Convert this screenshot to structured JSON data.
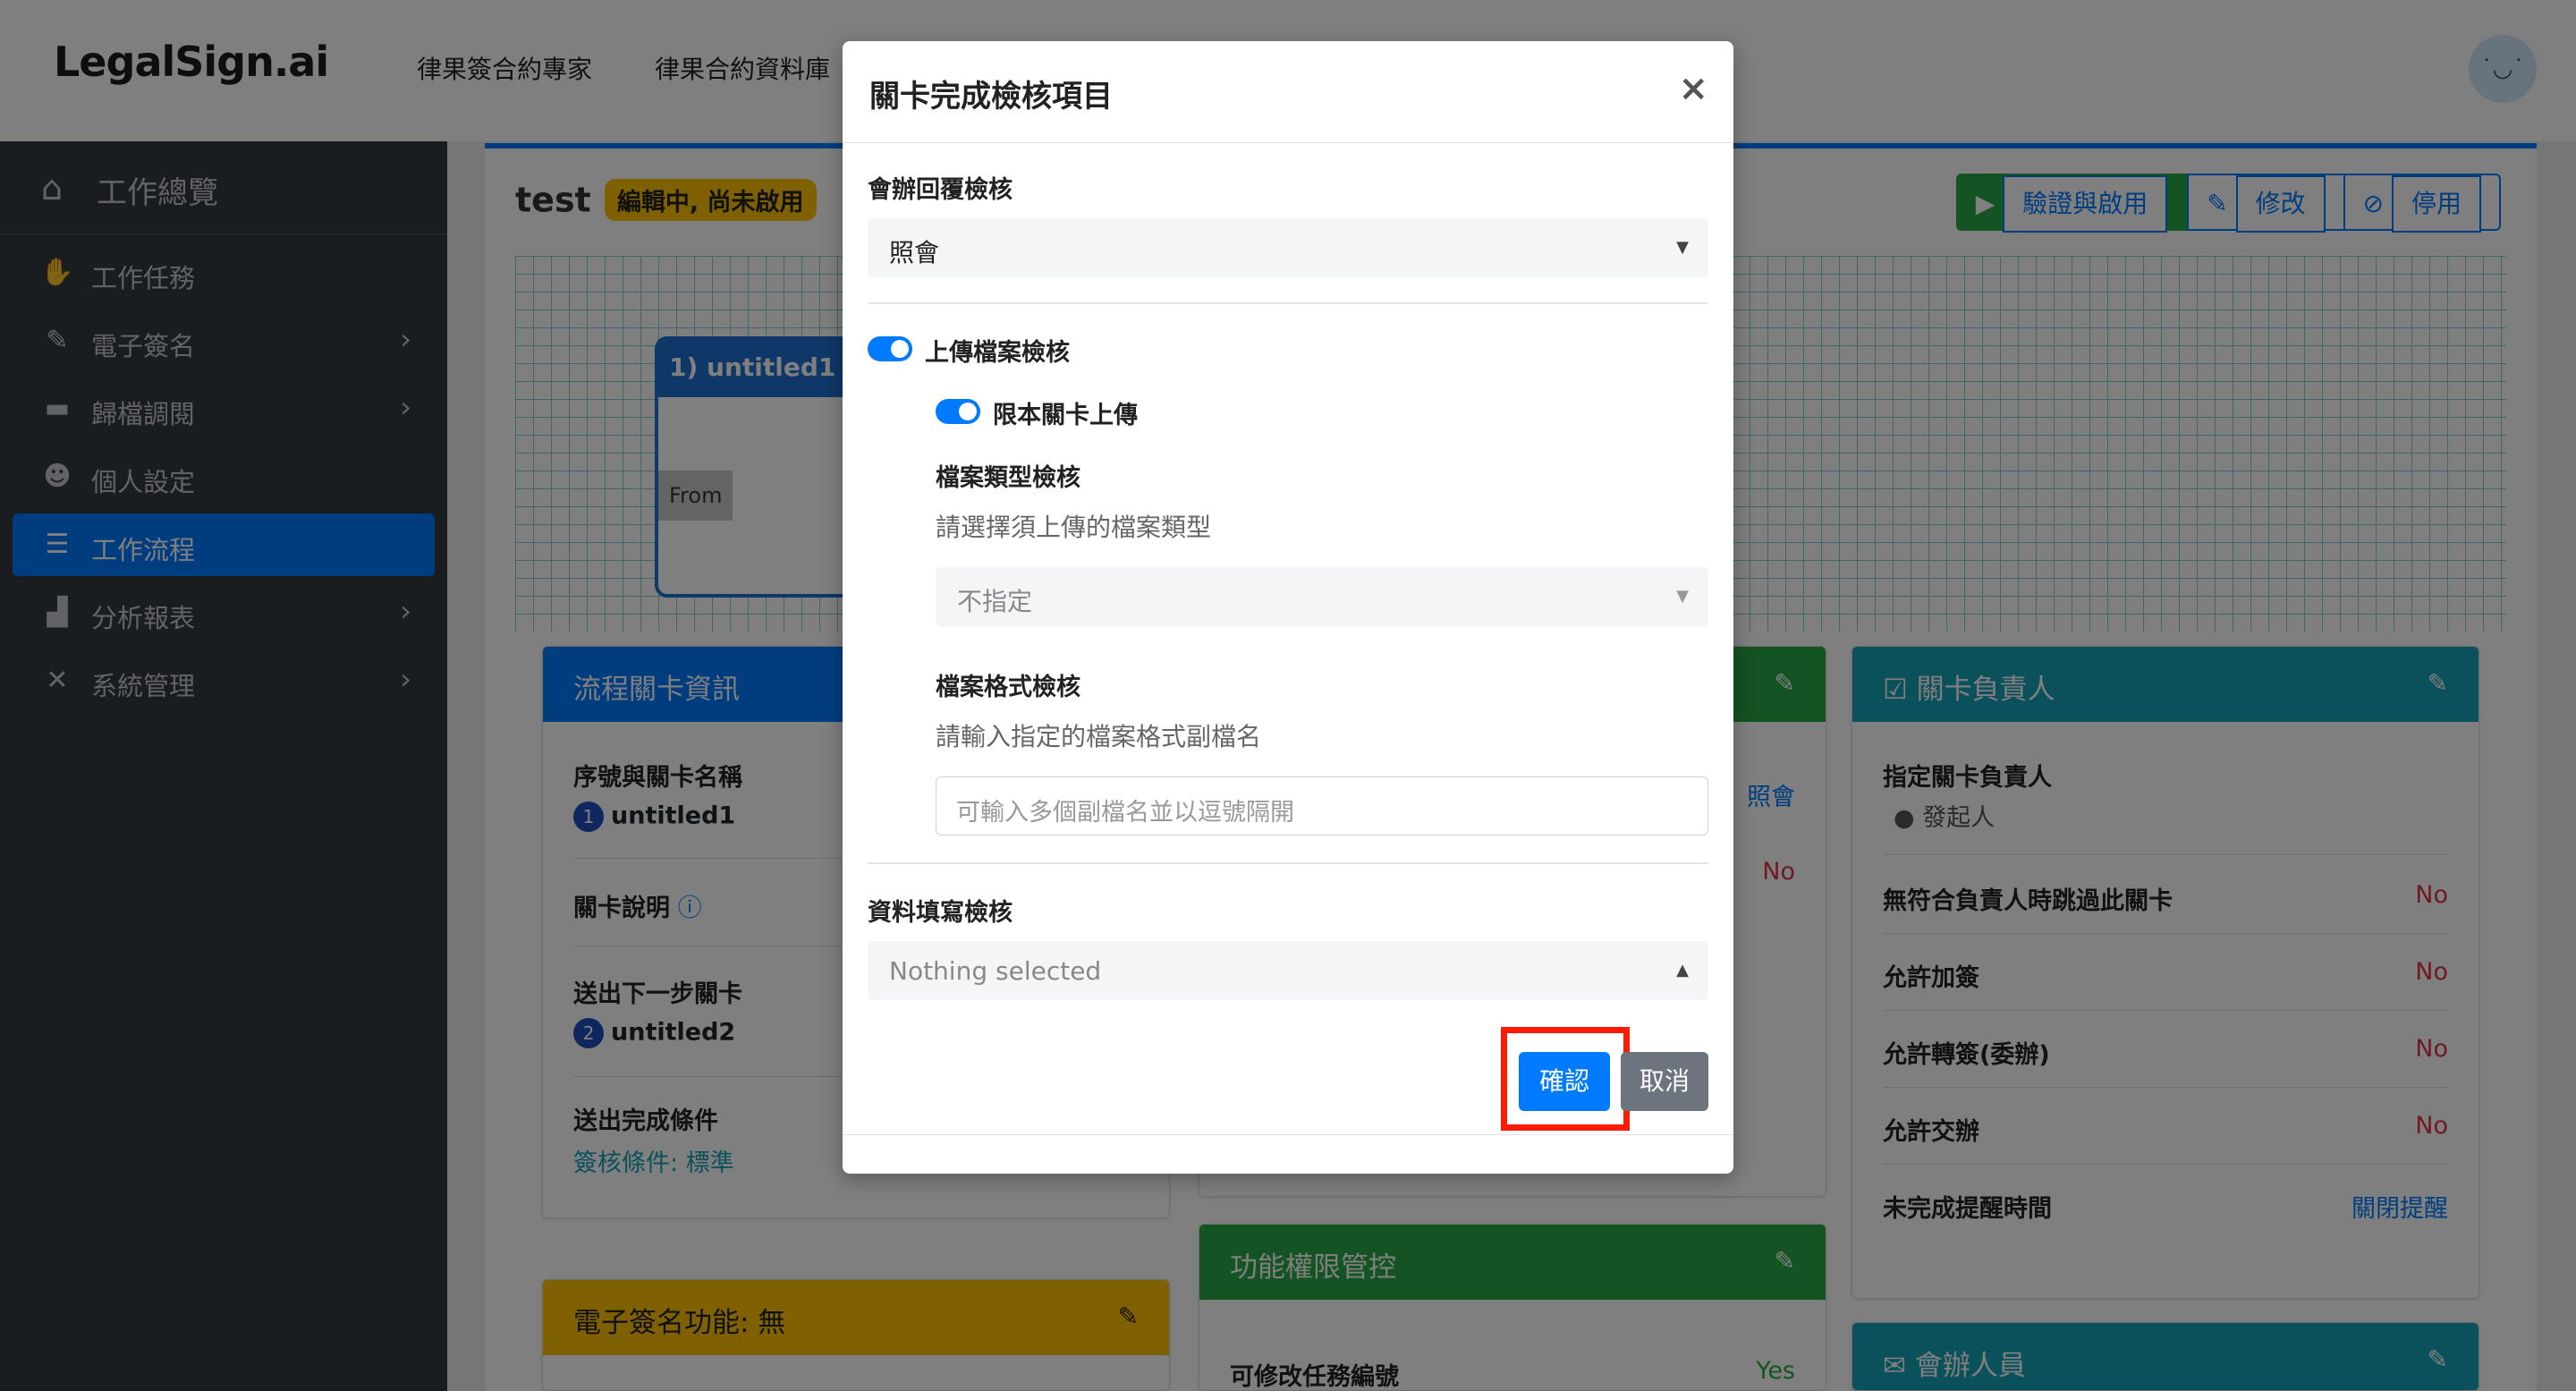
{
  "app": {
    "logo": "LegalSign.ai"
  },
  "topnav": {
    "item1": "律果簽合約專家",
    "item2": "律果合約資料庫"
  },
  "avatar": {
    "face": "˙◡˙"
  },
  "sidebar": {
    "overview": "工作總覽",
    "items": [
      {
        "label": "工作任務",
        "icon": "handshake-icon",
        "glyph": "✋",
        "chevron": false
      },
      {
        "label": "電子簽名",
        "icon": "signature-icon",
        "glyph": "✎",
        "chevron": true
      },
      {
        "label": "歸檔調閱",
        "icon": "archive-icon",
        "glyph": "▬",
        "chevron": true
      },
      {
        "label": "個人設定",
        "icon": "user-cog-icon",
        "glyph": "☻",
        "chevron": false
      },
      {
        "label": "工作流程",
        "icon": "list-icon",
        "glyph": "☰",
        "chevron": false
      },
      {
        "label": "分析報表",
        "icon": "chart-icon",
        "glyph": "▟",
        "chevron": true
      },
      {
        "label": "系統管理",
        "icon": "tools-icon",
        "glyph": "✕",
        "chevron": true
      }
    ]
  },
  "main": {
    "title": "test",
    "status_badge": "編輯中, 尚未啟用",
    "buttons": {
      "verify": "驗證與啟用",
      "edit": "修改",
      "disable": "停用"
    },
    "node": {
      "title": "1) untitled1",
      "from": "From"
    }
  },
  "panel_info": {
    "title": "流程關卡資訊",
    "seq_label": "序號與關卡名稱",
    "seq_num": "1",
    "seq_value": "untitled1",
    "desc_label": "關卡說明",
    "next_label": "送出下一步關卡",
    "next_num": "2",
    "next_value": "untitled2",
    "cond_label": "送出完成條件",
    "cond_value": "簽核條件: 標準"
  },
  "panel_mid": {
    "val1": "照會",
    "val2": "No"
  },
  "panel_owner": {
    "title": "關卡負責人",
    "assign_label": "指定關卡負責人",
    "assign_value": "發起人",
    "rows": [
      {
        "label": "無符合負責人時跳過此關卡",
        "value": "No"
      },
      {
        "label": "允許加簽",
        "value": "No"
      },
      {
        "label": "允許轉簽(委辦)",
        "value": "No"
      },
      {
        "label": "允許交辦",
        "value": "No"
      },
      {
        "label": "未完成提醒時間",
        "value": "關閉提醒"
      }
    ]
  },
  "panel_esign": {
    "title": "電子簽名功能: 無"
  },
  "panel_perm": {
    "title": "功能權限管控",
    "row_label": "可修改任務編號",
    "row_value": "Yes"
  },
  "panel_cosign": {
    "title": "會辦人員"
  },
  "modal": {
    "title": "關卡完成檢核項目",
    "close": "×",
    "reply_label": "會辦回覆檢核",
    "reply_value": "照會",
    "upload_label": "上傳檔案檢核",
    "upload_only_label": "限本關卡上傳",
    "filetype_label": "檔案類型檢核",
    "filetype_help": "請選擇須上傳的檔案類型",
    "filetype_value": "不指定",
    "ext_label": "檔案格式檢核",
    "ext_help": "請輸入指定的檔案格式副檔名",
    "ext_placeholder": "可輸入多個副檔名並以逗號隔開",
    "data_label": "資料填寫檢核",
    "data_value": "Nothing selected",
    "confirm": "確認",
    "cancel": "取消"
  },
  "colors": {
    "primary": "#007bff",
    "success": "#28a745",
    "warning": "#ffc107",
    "info": "#17a2b8",
    "danger": "#dc3545",
    "sidebar": "#343a40",
    "highlight": "#ff1a00"
  }
}
